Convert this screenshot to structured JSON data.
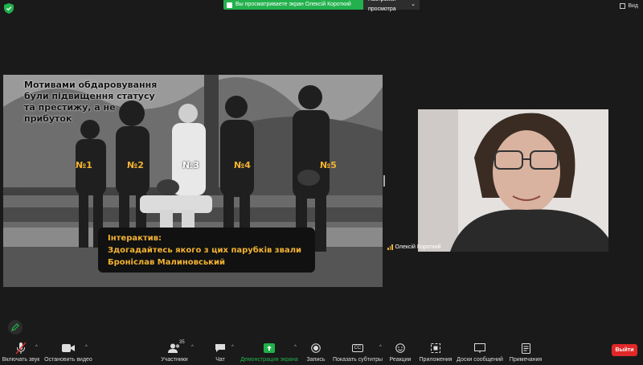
{
  "top_bar": {
    "share_banner": "Вы просматриваете экран Олексій Короткий",
    "share_settings": "Настройки просмотра",
    "view_label": "Вид"
  },
  "slide": {
    "title": "Мотивами обдаровування були підвищення статусу та престижу, а не прибуток",
    "numbers": [
      "№1",
      "№2",
      "№3",
      "№4",
      "№5"
    ],
    "interactive_heading": "Інтерактив:",
    "interactive_line1": "Здогадайтесь якого з цих парубків звали",
    "interactive_line2": "Броніслав Малиновський"
  },
  "participant": {
    "name": "Олексій Короткий"
  },
  "toolbar": {
    "mute": "Включать звук",
    "video": "Остановить видео",
    "participants": "Участники",
    "participants_count": "35",
    "chat": "Чат",
    "share": "Демонстрация экрана",
    "record": "Запись",
    "subtitles": "Показать субтитры",
    "subtitles_badge": "CC",
    "reactions": "Реакции",
    "apps": "Приложения",
    "whiteboards": "Доски сообщений",
    "notes": "Примечания",
    "exit": "Выйти"
  },
  "colors": {
    "share_green": "#22b14c",
    "exit_red": "#e02828",
    "slide_accent": "#f2b233"
  }
}
